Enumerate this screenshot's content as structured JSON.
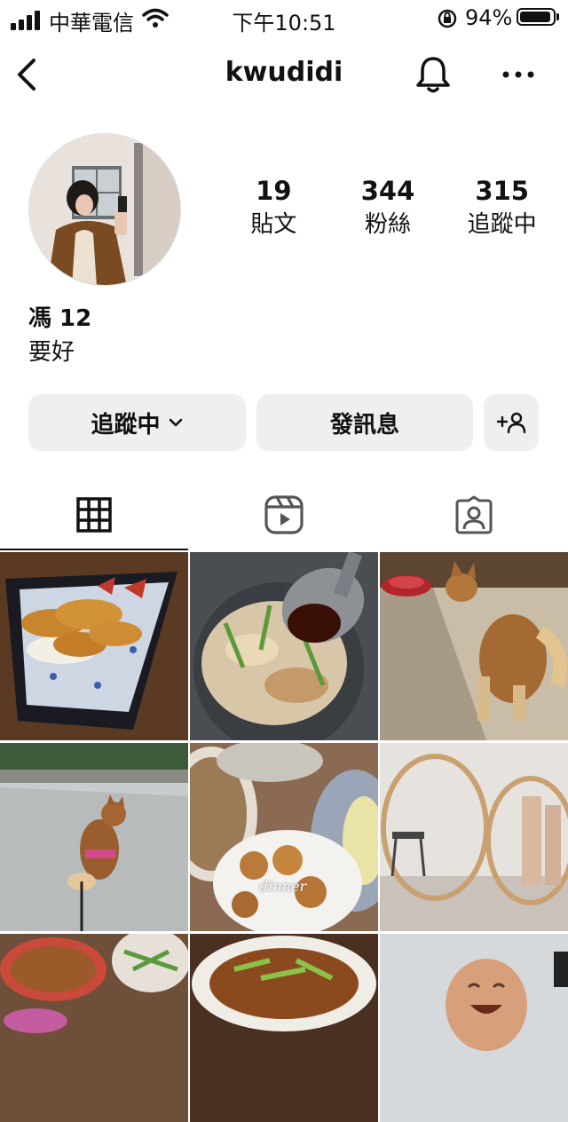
{
  "status_bar": {
    "carrier": "中華電信",
    "time": "下午10:51",
    "battery_percent": "94%",
    "battery_level": 0.94,
    "icons": [
      "signal-icon",
      "wifi-icon",
      "orientation-lock-icon",
      "battery-icon"
    ]
  },
  "header": {
    "username": "kwudidi",
    "icons": [
      "back-icon",
      "bell-icon",
      "more-icon"
    ]
  },
  "profile": {
    "stats": [
      {
        "value": "19",
        "label": "貼文"
      },
      {
        "value": "344",
        "label": "粉絲"
      },
      {
        "value": "315",
        "label": "追蹤中"
      }
    ],
    "display_name": "馮 12",
    "bio": "要好"
  },
  "actions": {
    "following_label": "追蹤中",
    "message_label": "發訊息",
    "icons": [
      "chevron-down-icon",
      "add-person-icon"
    ]
  },
  "tabs": [
    {
      "name": "grid",
      "icon": "grid-icon",
      "active": true
    },
    {
      "name": "reels",
      "icon": "reels-icon",
      "active": false
    },
    {
      "name": "tagged",
      "icon": "tagged-icon",
      "active": false
    }
  ],
  "grid": {
    "posts": [
      {
        "subject": "fried-shrimp"
      },
      {
        "subject": "stir-fry"
      },
      {
        "subject": "shiba-dog-indoor"
      },
      {
        "subject": "shiba-dog-outdoor"
      },
      {
        "subject": "dinner-table",
        "overlay_text": "dinner"
      },
      {
        "subject": "hoops"
      },
      {
        "subject": "noodle-bowls"
      },
      {
        "subject": "dish-with-greens"
      },
      {
        "subject": "laughing-figure"
      }
    ]
  },
  "colors": {
    "text": "#111111",
    "button_bg": "#efefef",
    "icon_gray": "#555555"
  }
}
